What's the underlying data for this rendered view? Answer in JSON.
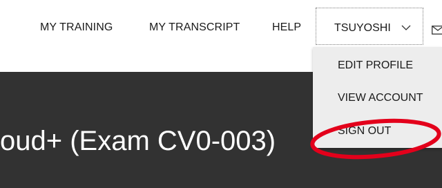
{
  "nav": {
    "items": [
      {
        "label": "MY TRAINING"
      },
      {
        "label": "MY TRANSCRIPT"
      },
      {
        "label": "HELP"
      }
    ],
    "user_label": "TSUYOSHI",
    "user_chevron_icon": "chevron-down-icon",
    "mail_icon": "mail-icon"
  },
  "hero": {
    "title": "oud+ (Exam CV0-003)"
  },
  "dropdown": {
    "items": [
      {
        "label": "EDIT PROFILE"
      },
      {
        "label": "VIEW ACCOUNT"
      },
      {
        "label": "SIGN OUT"
      }
    ]
  },
  "colors": {
    "hero_background": "#323232",
    "dropdown_background": "#ededed",
    "highlight": "#e3001b",
    "text": "#1a1a1a"
  }
}
